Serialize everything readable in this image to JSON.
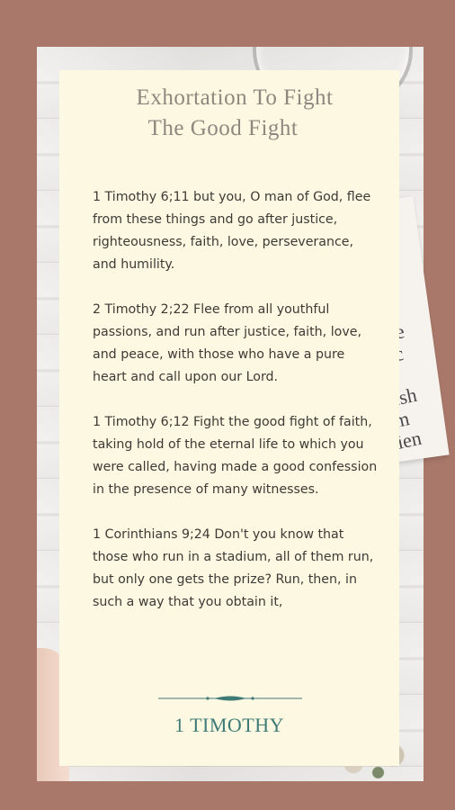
{
  "card": {
    "title_line1": "Exhortation To Fight",
    "title_line2": "The Good Fight",
    "verses": [
      "1 Timothy 6;11 but you, O man of God, flee from these things and go after justice, righteousness, faith, love, perseverance, and humility.",
      "2 Timothy 2;22 Flee from all youthful passions, and run after justice, faith, love, and peace, with those who have a pure heart and call upon our Lord.",
      "1 Timothy 6;12 Fight the good fight of faith, taking hold of the eternal life to which you were called, having made a good confession in the presence of many witnesses.",
      "1 Corinthians 9;24 Don't you know that those who run in a stadium, all of them run, but only one gets the prize? Run, then, in such a way that you obtain it,"
    ],
    "footer_label": "1 TIMOTHY"
  },
  "background": {
    "book_fragments": [
      "eatre",
      "earc",
      "e",
      "wish",
      "om",
      "cien"
    ]
  },
  "colors": {
    "frame": "#a9786a",
    "card": "#fdf8e1",
    "title": "#8c887f",
    "body_text": "#3d3a36",
    "accent": "#3e7a76"
  }
}
